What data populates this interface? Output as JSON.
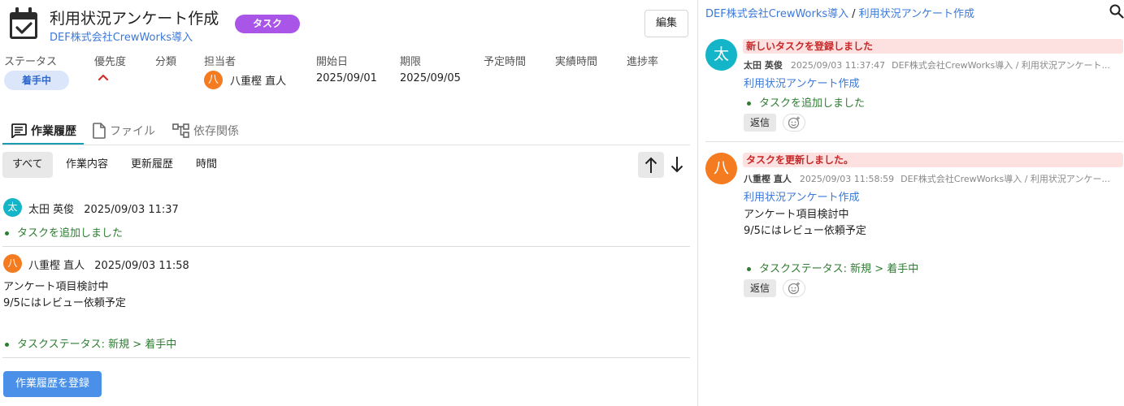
{
  "task": {
    "title": "利用状況アンケート作成",
    "project": "DEF株式会社CrewWorks導入",
    "type_badge": "タスク",
    "edit_label": "編集"
  },
  "fields": {
    "status_label": "ステータス",
    "status_value": "着手中",
    "priority_label": "優先度",
    "category_label": "分類",
    "assignee_label": "担当者",
    "assignee_initial": "八",
    "assignee_name": "八重樫 直人",
    "start_label": "開始日",
    "start_value": "2025/09/01",
    "due_label": "期限",
    "due_value": "2025/09/05",
    "planned_label": "予定時間",
    "actual_label": "実績時間",
    "progress_label": "進捗率"
  },
  "tabs": [
    {
      "label": "作業履歴",
      "icon": "comment-icon",
      "active": true
    },
    {
      "label": "ファイル",
      "icon": "file-icon",
      "active": false
    },
    {
      "label": "依存関係",
      "icon": "dependency-icon",
      "active": false
    }
  ],
  "filters": [
    {
      "label": "すべて",
      "active": true
    },
    {
      "label": "作業内容",
      "active": false
    },
    {
      "label": "更新履歴",
      "active": false
    },
    {
      "label": "時間",
      "active": false
    }
  ],
  "history": [
    {
      "initial": "太",
      "avatar_color": "#15b5c9",
      "author": "太田 英俊",
      "time": "2025/09/03 11:37",
      "body": "",
      "change": "タスクを追加しました"
    },
    {
      "initial": "八",
      "avatar_color": "#f47b20",
      "author": "八重樫 直人",
      "time": "2025/09/03 11:58",
      "body": "アンケート項目検討中\n9/5にはレビュー依頼予定",
      "change": "タスクステータス: 新規 > 着手中"
    }
  ],
  "register_label": "作業履歴を登録",
  "panel": {
    "breadcrumb_project": "DEF株式会社CrewWorks導入",
    "breadcrumb_sep": "/",
    "breadcrumb_task": "利用状況アンケート作成",
    "reply_label": "返信",
    "notifications": [
      {
        "initial": "太",
        "avatar_color": "#15b5c9",
        "title": "新しいタスクを登録しました",
        "author": "太田 英俊",
        "time": "2025/09/03 11:37:47",
        "path": "DEF株式会社CrewWorks導入 / 利用状況アンケート...",
        "link": "利用状況アンケート作成",
        "body": "",
        "change": "タスクを追加しました"
      },
      {
        "initial": "八",
        "avatar_color": "#f47b20",
        "title": "タスクを更新しました。",
        "author": "八重樫 直人",
        "time": "2025/09/03 11:58:59",
        "path": "DEF株式会社CrewWorks導入 / 利用状況アンケー...",
        "link": "利用状況アンケート作成",
        "body": "アンケート項目検討中\n9/5にはレビュー依頼予定",
        "change": "タスクステータス: 新規 > 着手中"
      }
    ]
  },
  "colors": {
    "accent": "#1a9db0",
    "link": "#3b78d8",
    "badge": "#a855e8",
    "primary_button": "#4a90e8",
    "status_pill": "#dbe6fa",
    "change_text": "#2e7d32",
    "notif_title_bg": "#fde1e1"
  }
}
